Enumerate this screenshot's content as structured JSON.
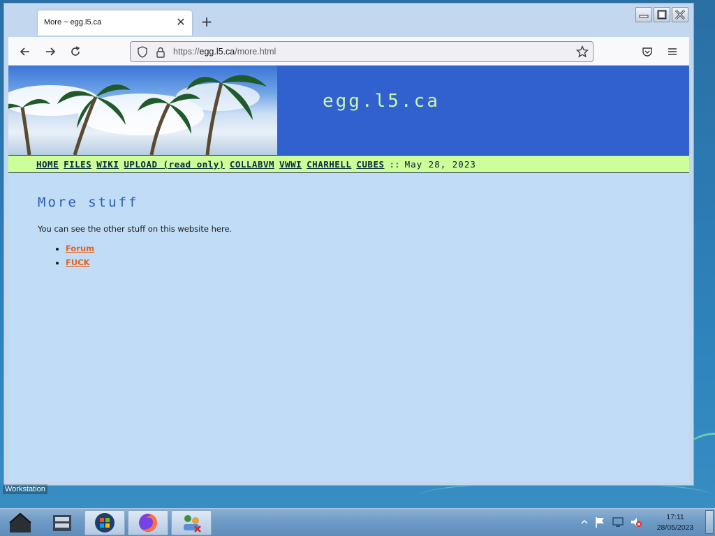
{
  "browser": {
    "tab_title": "More ~ egg.l5.ca",
    "url_prefix": "https://",
    "url_host": "egg.l5.ca",
    "url_path": "/more.html"
  },
  "site": {
    "banner_title": "egg.l5.ca",
    "nav": [
      "HOME",
      "FILES",
      "WIKI",
      "UPLOAD (read only)",
      "COLLABVM",
      "VWWI",
      "CHARHELL",
      "CUBES"
    ],
    "nav_separator": "::",
    "date": "May 28, 2023",
    "heading": "More stuff",
    "intro": "You can see the other stuff on this website here.",
    "links": [
      "Forum",
      "FUCK"
    ]
  },
  "desktop": {
    "tooltip": "Workstation"
  },
  "taskbar": {
    "time": "17:11",
    "date": "28/05/2023"
  },
  "colors": {
    "banner_bg": "#3161cf",
    "nav_bg": "#ccff99",
    "page_bg": "#c0dcf6",
    "link": "#e3621f",
    "heading": "#2a5db0"
  }
}
